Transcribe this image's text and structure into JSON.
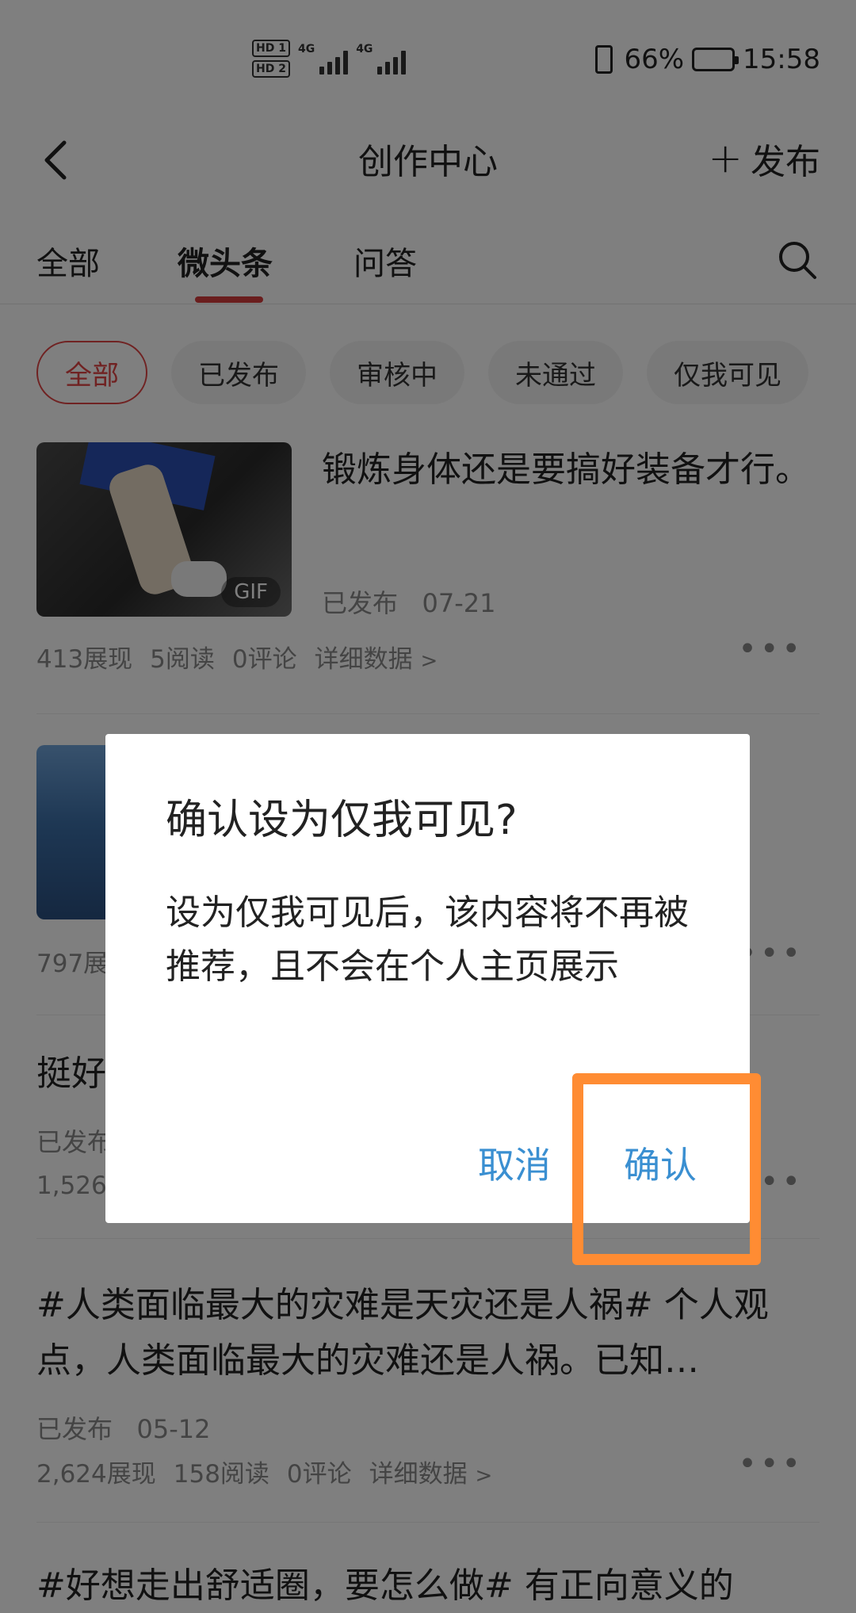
{
  "status_bar": {
    "hd1": "HD 1",
    "hd2": "HD 2",
    "net1": "4G",
    "net2": "4G",
    "battery": "66%",
    "time": "15:58"
  },
  "header": {
    "title": "创作中心",
    "publish_label": "发布",
    "publish_icon": "plus-icon",
    "back_icon": "back-chevron-icon"
  },
  "tabs": [
    {
      "label": "全部",
      "active": false
    },
    {
      "label": "微头条",
      "active": true
    },
    {
      "label": "问答",
      "active": false
    }
  ],
  "filters": [
    {
      "label": "全部",
      "active": true
    },
    {
      "label": "已发布",
      "active": false
    },
    {
      "label": "审核中",
      "active": false
    },
    {
      "label": "未通过",
      "active": false
    },
    {
      "label": "仅我可见",
      "active": false
    }
  ],
  "posts": [
    {
      "title": "锻炼身体还是要搞好装备才行。",
      "status": "已发布",
      "date": "07-21",
      "badge": "GIF",
      "views": "413展现",
      "reads": "5阅读",
      "comments": "0评论",
      "details": "详细数据"
    },
    {
      "views_partial": "797展"
    },
    {
      "title_partial": "挺好",
      "status_partial": "已发布",
      "views_partial": "1,526"
    },
    {
      "title": "#人类面临最大的灾难是天灾还是人祸# 个人观点，人类面临最大的灾难还是人祸。已知…",
      "status": "已发布",
      "date": "05-12",
      "views": "2,624展现",
      "reads": "158阅读",
      "comments": "0评论",
      "details": "详细数据"
    },
    {
      "title": "#好想走出舒适圈，要怎么做# 有正向意义的"
    }
  ],
  "dialog": {
    "title": "确认设为仅我可见?",
    "body": "设为仅我可见后，该内容将不再被推荐，且不会在个人主页展示",
    "cancel_label": "取消",
    "confirm_label": "确认",
    "button_color": "#3a8fd1"
  },
  "highlight_color": "#ff8c33",
  "accent_color": "#e04545"
}
